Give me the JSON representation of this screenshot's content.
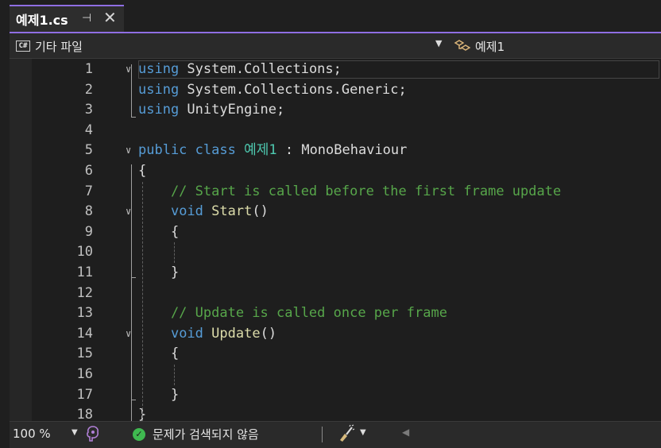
{
  "tab": {
    "title": "예제1.cs",
    "pin_glyph": "⊣",
    "close_glyph": "✕"
  },
  "navbar": {
    "project_icon_text": "C#",
    "project_label": "기타 파일",
    "class_label": "예제1"
  },
  "code": {
    "line_numbers": [
      "1",
      "2",
      "3",
      "4",
      "5",
      "6",
      "7",
      "8",
      "9",
      "10",
      "11",
      "12",
      "13",
      "14",
      "15",
      "16",
      "17",
      "18"
    ],
    "lines": [
      [
        {
          "t": "using",
          "c": "kw"
        },
        {
          "t": " System.Collections;",
          "c": "pl"
        }
      ],
      [
        {
          "t": "using",
          "c": "kw"
        },
        {
          "t": " System.Collections.Generic;",
          "c": "pl"
        }
      ],
      [
        {
          "t": "using",
          "c": "kw"
        },
        {
          "t": " UnityEngine;",
          "c": "pl"
        }
      ],
      [],
      [
        {
          "t": "public",
          "c": "kw"
        },
        {
          "t": " ",
          "c": "pl"
        },
        {
          "t": "class",
          "c": "kw"
        },
        {
          "t": " ",
          "c": "pl"
        },
        {
          "t": "예제1",
          "c": "ty"
        },
        {
          "t": " : MonoBehaviour",
          "c": "pl"
        }
      ],
      [
        {
          "t": "{",
          "c": "pl"
        }
      ],
      [
        {
          "t": "    // Start is called before the first frame update",
          "c": "cm"
        }
      ],
      [
        {
          "t": "    ",
          "c": "pl"
        },
        {
          "t": "void",
          "c": "kw"
        },
        {
          "t": " ",
          "c": "pl"
        },
        {
          "t": "Start",
          "c": "fn"
        },
        {
          "t": "()",
          "c": "pl"
        }
      ],
      [
        {
          "t": "    {",
          "c": "pl"
        }
      ],
      [],
      [
        {
          "t": "    }",
          "c": "pl"
        }
      ],
      [],
      [
        {
          "t": "    // Update is called once per frame",
          "c": "cm"
        }
      ],
      [
        {
          "t": "    ",
          "c": "pl"
        },
        {
          "t": "void",
          "c": "kw"
        },
        {
          "t": " ",
          "c": "pl"
        },
        {
          "t": "Update",
          "c": "fn"
        },
        {
          "t": "()",
          "c": "pl"
        }
      ],
      [
        {
          "t": "    {",
          "c": "pl"
        }
      ],
      [],
      [
        {
          "t": "    }",
          "c": "pl"
        }
      ],
      [
        {
          "t": "}",
          "c": "pl"
        }
      ]
    ],
    "fold_lines": [
      1,
      5,
      8,
      14
    ]
  },
  "status": {
    "zoom": "100 %",
    "message": "문제가 검색되지 않음"
  },
  "colors": {
    "accent": "#8f6ee3",
    "keyword": "#569cd6",
    "type": "#4ec9b0",
    "comment": "#57a64a",
    "ok": "#3fb950"
  }
}
